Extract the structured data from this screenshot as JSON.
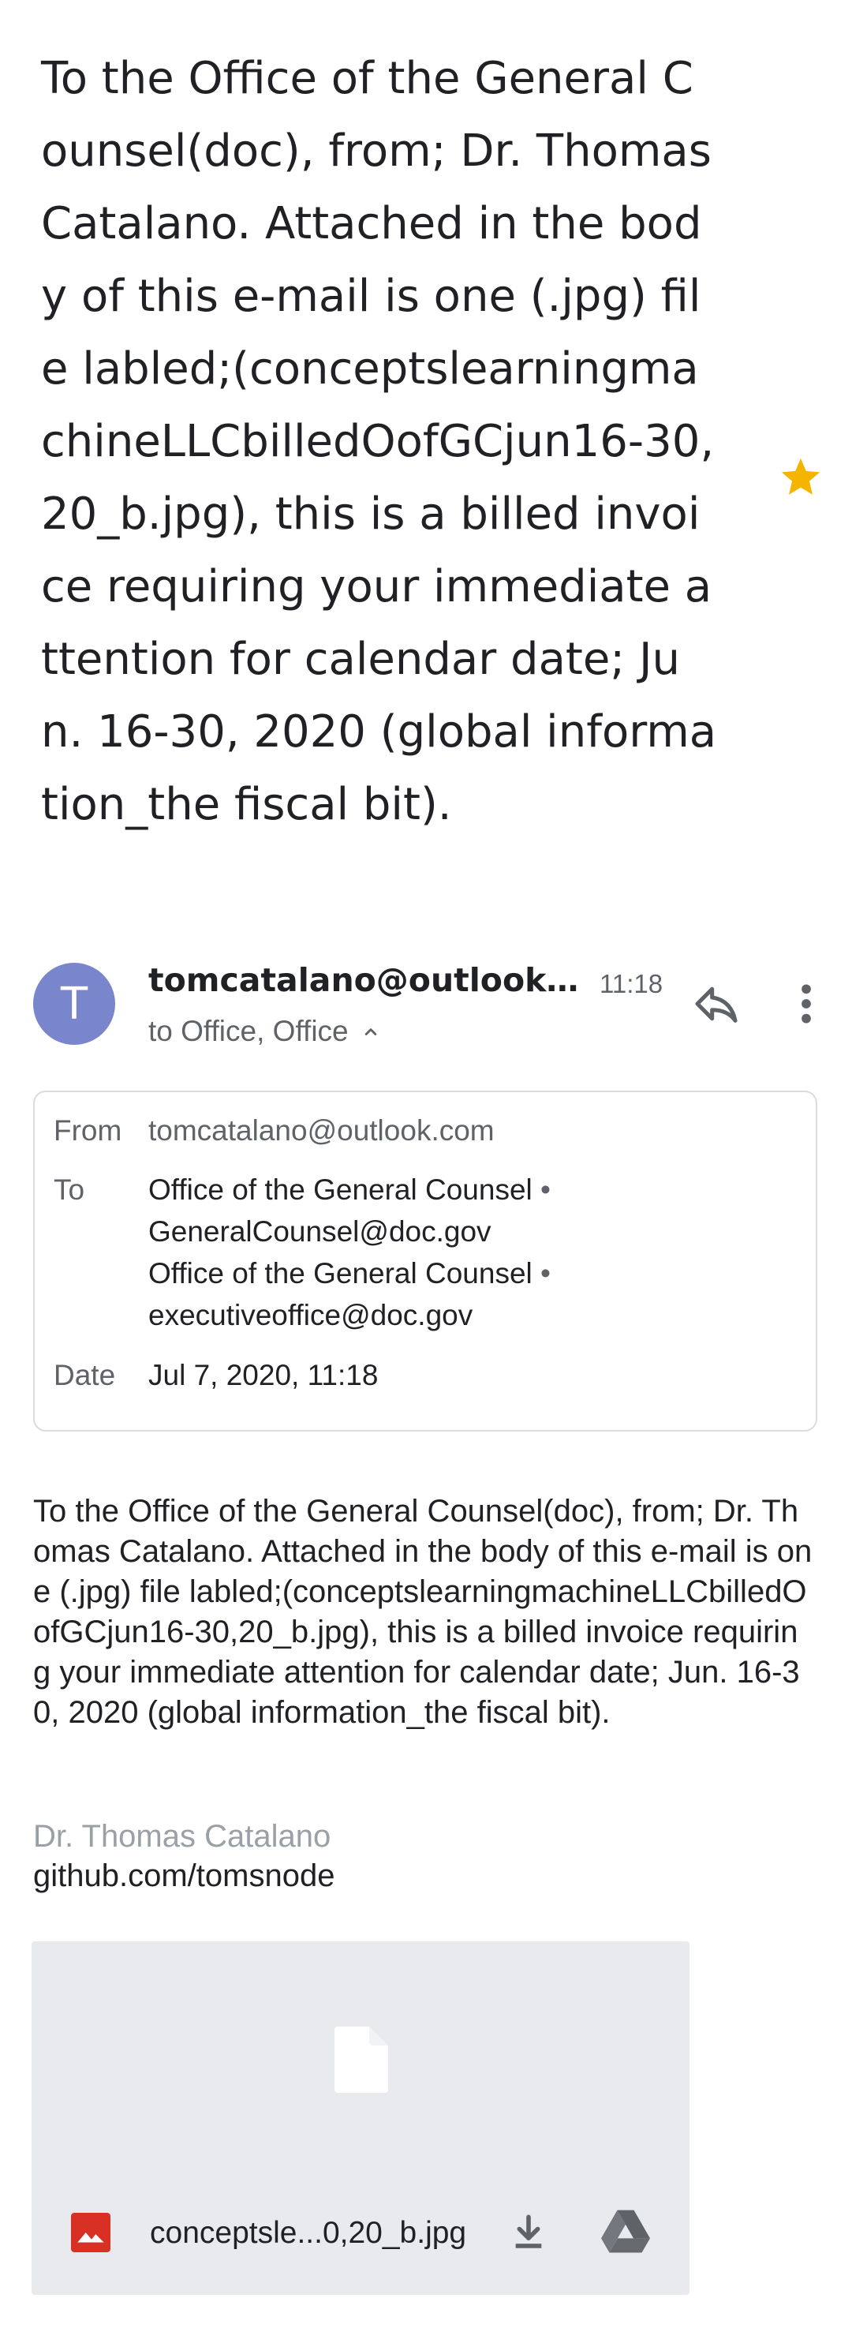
{
  "email": {
    "subject": "To the Office of the General Counsel(doc), from; Dr. Thomas Catalano. Attached in the body of this e-mail is one (.jpg) file labled;(conceptslearningmachineLLCbilledOofGCjun16-30,20_b.jpg), this is a billed invoice requiring your immediate attention for calendar date; Jun. 16-30, 2020 (global information_the fiscal bit).",
    "starred": true,
    "star_color": "#f4b400"
  },
  "sender": {
    "avatar_letter": "T",
    "avatar_color": "#7986cb",
    "name": "tomcatalano@outlook.c...",
    "time": "11:18",
    "recipients_summary": "to Office, Office"
  },
  "details": {
    "from_label": "From",
    "from_value": "tomcatalano@outlook.com",
    "to_label": "To",
    "to": [
      {
        "name": "Office of the General Counsel",
        "separator": "•",
        "email": "GeneralCounsel@doc.gov"
      },
      {
        "name": "Office of the General Counsel",
        "separator": "•",
        "email": "executiveoffice@doc.gov"
      }
    ],
    "date_label": "Date",
    "date_value": "Jul 7, 2020, 11:18"
  },
  "body": {
    "text": "To the Office of the General Counsel(doc), from; Dr. Thomas Catalano. Attached in the body of this e-mail is one (.jpg) file labled;(conceptslearningmachineLLCbilledOofGCjun16-30,20_b.jpg), this is a billed invoice requiring your immediate attention for calendar date; Jun. 16-30, 2020 (global information_the fiscal bit).",
    "signature_name": "Dr. Thomas Catalano",
    "signature_link": "github.com/tomsnode"
  },
  "attachment": {
    "filename": "conceptsle...0,20_b.jpg",
    "file_icon": "file-icon",
    "type_icon": "image-icon",
    "type_icon_color": "#d93025",
    "actions": [
      "download-icon",
      "drive-icon"
    ]
  }
}
